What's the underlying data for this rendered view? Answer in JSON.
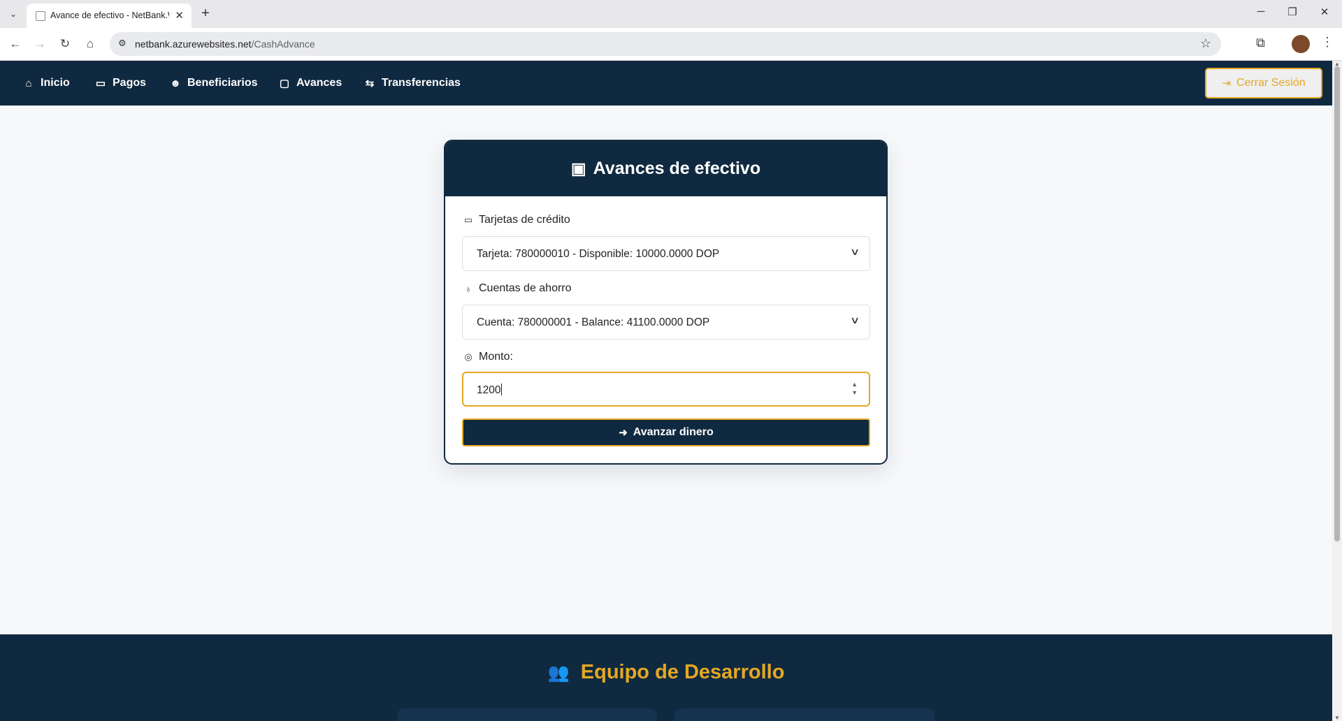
{
  "browser": {
    "tab_title": "Avance de efectivo - NetBank.W",
    "url_domain": "netbank.azurewebsites.net",
    "url_path": "/CashAdvance",
    "icons": [
      "tab-search-icon",
      "favicon-icon",
      "close-icon",
      "new-tab-icon",
      "minimize-icon",
      "maximize-icon",
      "close-window-icon",
      "back-icon",
      "forward-icon",
      "reload-icon",
      "home-icon",
      "site-info-icon",
      "star-icon",
      "extensions-icon",
      "profile-avatar",
      "menu-icon"
    ]
  },
  "nav": {
    "items": [
      {
        "label": "Inicio",
        "icon": "home-icon"
      },
      {
        "label": "Pagos",
        "icon": "credit-card-icon"
      },
      {
        "label": "Beneficiarios",
        "icon": "person-lines-icon"
      },
      {
        "label": "Avances",
        "icon": "wallet-icon"
      },
      {
        "label": "Transferencias",
        "icon": "arrow-left-right-icon"
      }
    ],
    "logout_label": "Cerrar Sesión"
  },
  "card": {
    "title": "Avances de efectivo",
    "credit_label": "Tarjetas de crédito",
    "credit_selected": "Tarjeta: 780000010 - Disponible: 10000.0000 DOP",
    "savings_label": "Cuentas de ahorro",
    "savings_selected": "Cuenta: 780000001 - Balance: 41100.0000 DOP",
    "amount_label": "Monto:",
    "amount_value": "1200",
    "submit_label": "Avanzar dinero"
  },
  "footer": {
    "title": "Equipo de Desarrollo"
  },
  "colors": {
    "navy": "#0f2940",
    "gold": "#e5a823",
    "page_bg": "#f7f8fa"
  }
}
